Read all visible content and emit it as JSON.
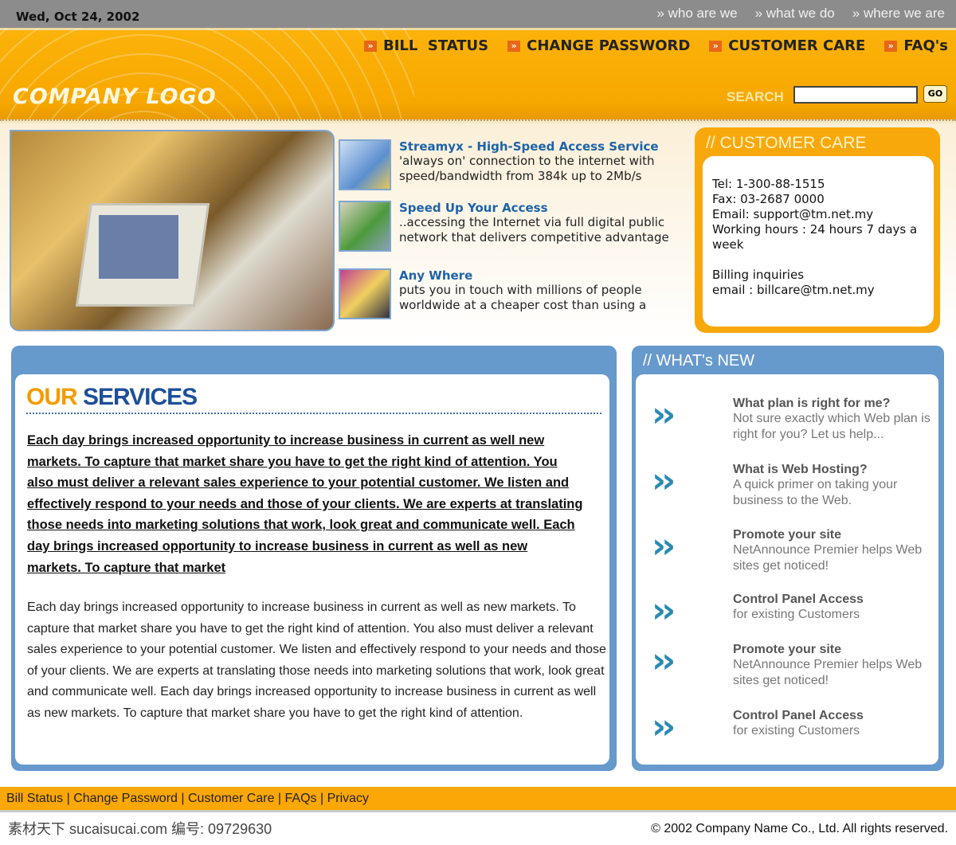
{
  "topbar": {
    "date": "Wed, Oct 24, 2002",
    "links": [
      "» who are we",
      "» what we do",
      "» where we are"
    ]
  },
  "nav": {
    "icon": "double-chevron-icon",
    "items": [
      "BILL  STATUS",
      "CHANGE PASSWORD",
      "CUSTOMER CARE",
      "FAQ's"
    ]
  },
  "header": {
    "logo": "COMPANY LOGO",
    "search_label": "SEARCH",
    "search_value": "",
    "go": "GO"
  },
  "features": [
    {
      "title": "Streamyx - High-Speed Access Service",
      "text": "'always on' connection to the internet with speed/bandwidth from 384k up to 2Mb/s"
    },
    {
      "title": "Speed Up Your Access",
      "text": "..accessing the Internet via full digital public network that delivers competitive advantage"
    },
    {
      "title": "Any Where",
      "text": "puts you in touch with millions of people worldwide at a cheaper cost than using a"
    }
  ],
  "customer_care": {
    "title": "// CUSTOMER CARE",
    "lines": [
      "Tel: 1-300-88-1515",
      "Fax: 03-2687 0000",
      "Email: support@tm.net.my",
      "Working hours : 24 hours 7 days a week",
      "",
      "Billing inquiries",
      "email : billcare@tm.net.my"
    ]
  },
  "services": {
    "title_a": "OUR",
    "title_b": " SERVICES",
    "colors": {
      "our": "#f39c00",
      "services": "#1d4f9a"
    },
    "bold_text": "Each day brings increased opportunity to increase business in current as well new markets. To capture that market share you have to get the right kind of attention. You also must deliver a relevant sales experience to your potential customer. We listen and effectively respond to your needs and those of your clients. We are experts at translating those needs into marketing solutions that work, look great and communicate well. Each day brings increased opportunity to increase business in current as well as new markets. To capture that market",
    "text": "Each day brings increased opportunity to increase business in current as well as new markets. To capture that market share you have to get the right kind of attention. You also must deliver a relevant sales experience to your potential customer. We listen and effectively respond to your needs and those of your clients. We are experts at translating those needs into marketing solutions that work, look great and communicate well. Each day brings increased opportunity to increase business in current as well as new markets. To capture that market share you have to get the right kind of attention."
  },
  "whats_new": {
    "title": "// WHAT's NEW",
    "items": [
      {
        "title": "What plan is right for me?",
        "text": "Not sure exactly which Web plan is right for you? Let us help..."
      },
      {
        "title": "What is Web Hosting?",
        "text": "A quick primer on taking your business to the Web."
      },
      {
        "title": "Promote your site",
        "text": "NetAnnounce Premier helps Web sites get noticed!"
      },
      {
        "title": "Control Panel Access",
        "text": "for existing Customers"
      },
      {
        "title": "Promote your site",
        "text": "NetAnnounce Premier helps Web sites get noticed!"
      },
      {
        "title": "Control Panel Access",
        "text": "for existing Customers"
      }
    ]
  },
  "footer": {
    "links": [
      "Bill Status",
      "Change Password",
      "Customer Care",
      "FAQs",
      "Privacy"
    ],
    "watermark": "素材天下 sucaisucai.com  编号: 09729630",
    "copyright": "© 2002 Company Name Co., Ltd. All rights reserved."
  }
}
